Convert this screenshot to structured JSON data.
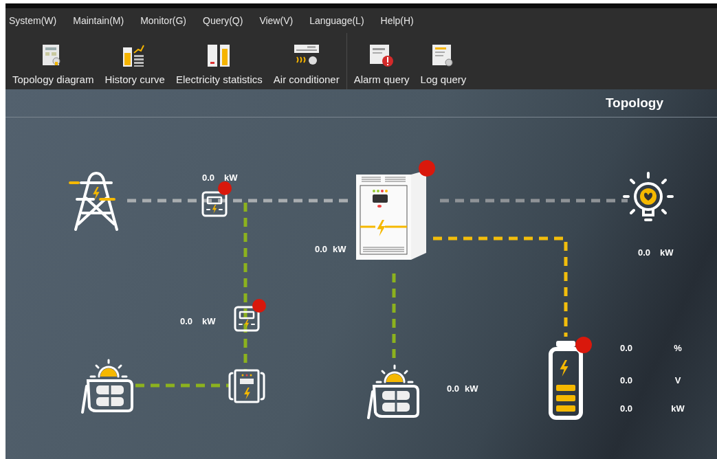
{
  "menu": [
    {
      "label": "System(W)"
    },
    {
      "label": "Maintain(M)"
    },
    {
      "label": "Monitor(G)"
    },
    {
      "label": "Query(Q)"
    },
    {
      "label": "View(V)"
    },
    {
      "label": "Language(L)"
    },
    {
      "label": "Help(H)"
    }
  ],
  "toolbar_groups": [
    [
      {
        "kind": "topology",
        "label": "Topology diagram"
      },
      {
        "kind": "history",
        "label": "History curve"
      },
      {
        "kind": "electricity",
        "label": "Electricity statistics"
      },
      {
        "kind": "aircon",
        "label": "Air conditioner"
      }
    ],
    [
      {
        "kind": "alarm",
        "label": "Alarm query"
      },
      {
        "kind": "log",
        "label": "Log query"
      }
    ]
  ],
  "topology": {
    "title": "Topology",
    "nodes": [
      {
        "kind": "grid"
      },
      {
        "kind": "grid_meter",
        "value": "0.0",
        "unit": "kW",
        "alarm": true
      },
      {
        "kind": "inverter",
        "value": "0.0",
        "unit": "kW",
        "alarm": true
      },
      {
        "kind": "load",
        "value": "0.0",
        "unit": "kW"
      },
      {
        "kind": "pv_meter",
        "value": "0.0",
        "unit": "kW",
        "alarm": true
      },
      {
        "kind": "pv_left"
      },
      {
        "kind": "converter"
      },
      {
        "kind": "pv_right",
        "value": "0.0",
        "unit": "kW"
      },
      {
        "kind": "battery",
        "alarm": true,
        "readings": [
          {
            "value": "0.0",
            "unit": "%"
          },
          {
            "value": "0.0",
            "unit": "V"
          },
          {
            "value": "0.0",
            "unit": "kW"
          }
        ]
      }
    ]
  }
}
